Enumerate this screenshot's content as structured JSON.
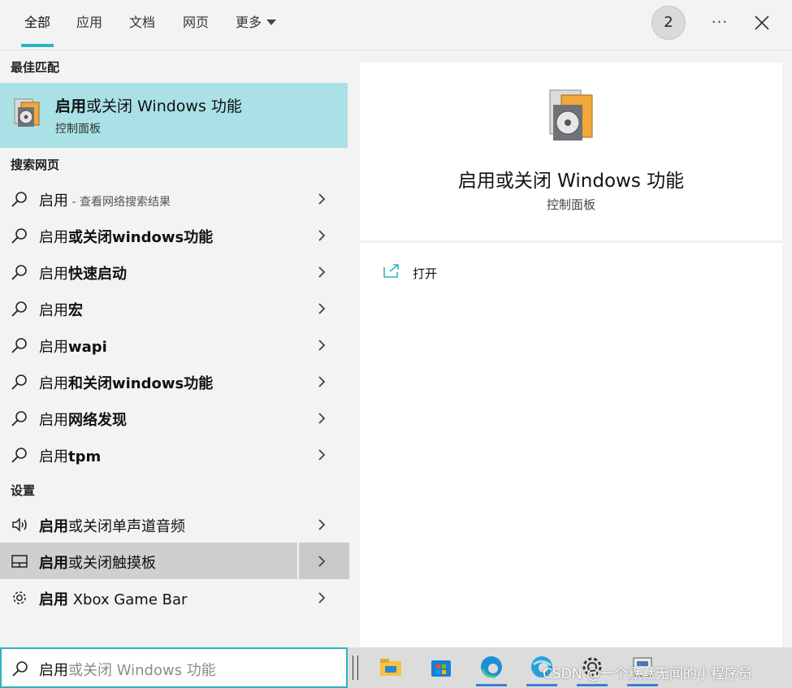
{
  "tabs": [
    {
      "label": "全部",
      "active": true
    },
    {
      "label": "应用",
      "active": false
    },
    {
      "label": "文档",
      "active": false
    },
    {
      "label": "网页",
      "active": false
    },
    {
      "label": "更多",
      "active": false
    }
  ],
  "header": {
    "badge_count": "2",
    "more_icon": "ellipsis-icon",
    "close_icon": "close-icon"
  },
  "sections": {
    "best_match": "最佳匹配",
    "search_web": "搜索网页",
    "settings": "设置"
  },
  "best_match": {
    "title_bold": "启用",
    "title_rest": "或关闭 Windows 功能",
    "subtitle": "控制面板",
    "icon": "windows-features-icon"
  },
  "web_results": [
    {
      "normal": "启用",
      "bold": "",
      "hint": " - 查看网络搜索结果"
    },
    {
      "normal": "启用",
      "bold": "或关闭windows功能",
      "hint": ""
    },
    {
      "normal": "启用",
      "bold": "快速启动",
      "hint": ""
    },
    {
      "normal": "启用",
      "bold": "宏",
      "hint": ""
    },
    {
      "normal": "启用",
      "bold": "wapi",
      "hint": ""
    },
    {
      "normal": "启用",
      "bold": "和关闭windows功能",
      "hint": ""
    },
    {
      "normal": "启用",
      "bold": "网络发现",
      "hint": ""
    },
    {
      "normal": "启用",
      "bold": "tpm",
      "hint": ""
    }
  ],
  "settings_results": [
    {
      "bold": "启用",
      "normal": "或关闭单声道音频",
      "icon": "speaker-icon"
    },
    {
      "bold": "启用",
      "normal": "或关闭触摸板",
      "icon": "touchpad-icon"
    },
    {
      "bold": "启用",
      "normal": " Xbox Game Bar",
      "icon": "gear-icon"
    }
  ],
  "detail": {
    "title": "启用或关闭 Windows 功能",
    "subtitle": "控制面板",
    "action_label": "打开",
    "action_icon": "open-external-icon"
  },
  "search": {
    "typed": "启用",
    "suggestion": "或关闭 Windows 功能"
  },
  "taskbar": {
    "items": [
      "file-explorer-icon",
      "store-icon",
      "edge-icon",
      "edge-beta-icon",
      "settings-icon",
      "app-icon"
    ],
    "watermark": "CSDN @一个默默无闻的小程序员"
  },
  "colors": {
    "accent": "#2bb5c0",
    "best_match_bg": "#a9e1e6",
    "hover_bg": "#cfcfcf"
  }
}
